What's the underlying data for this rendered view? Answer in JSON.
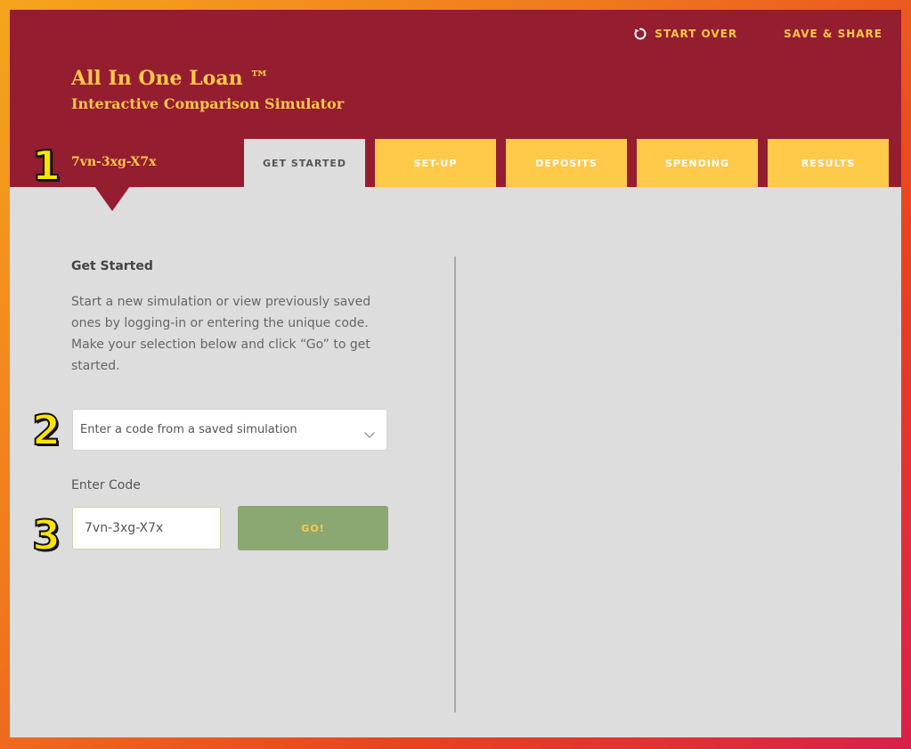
{
  "header": {
    "brand_title": "All In One Loan ™",
    "brand_subtitle": "Interactive Comparison Simulator",
    "simulation_code": "7vn-3xg-X7x",
    "start_over_label": "START OVER",
    "save_share_label": "SAVE & SHARE"
  },
  "tabs": [
    {
      "label": "GET STARTED",
      "active": true
    },
    {
      "label": "SET-UP",
      "active": false
    },
    {
      "label": "DEPOSITS",
      "active": false
    },
    {
      "label": "SPENDING",
      "active": false
    },
    {
      "label": "RESULTS",
      "active": false
    }
  ],
  "badges": [
    "1",
    "2",
    "3"
  ],
  "panel": {
    "title": "Get Started",
    "description": "Start a new simulation or view previously saved ones by logging-in or entering the unique code. Make your selection below and click “Go” to get started.",
    "select_value": "Enter a code from a saved simulation",
    "enter_code_label": "Enter Code",
    "code_value": "7vn-3xg-X7x",
    "go_label": "GO!"
  },
  "colors": {
    "header_bg": "#951d30",
    "accent_gold": "#ffc94a",
    "panel_bg": "#dddddd",
    "go_button": "#8ba873",
    "badge_yellow": "#ffe400"
  },
  "icons": {
    "start_over": "refresh-icon",
    "select": "chevron-down-icon"
  }
}
